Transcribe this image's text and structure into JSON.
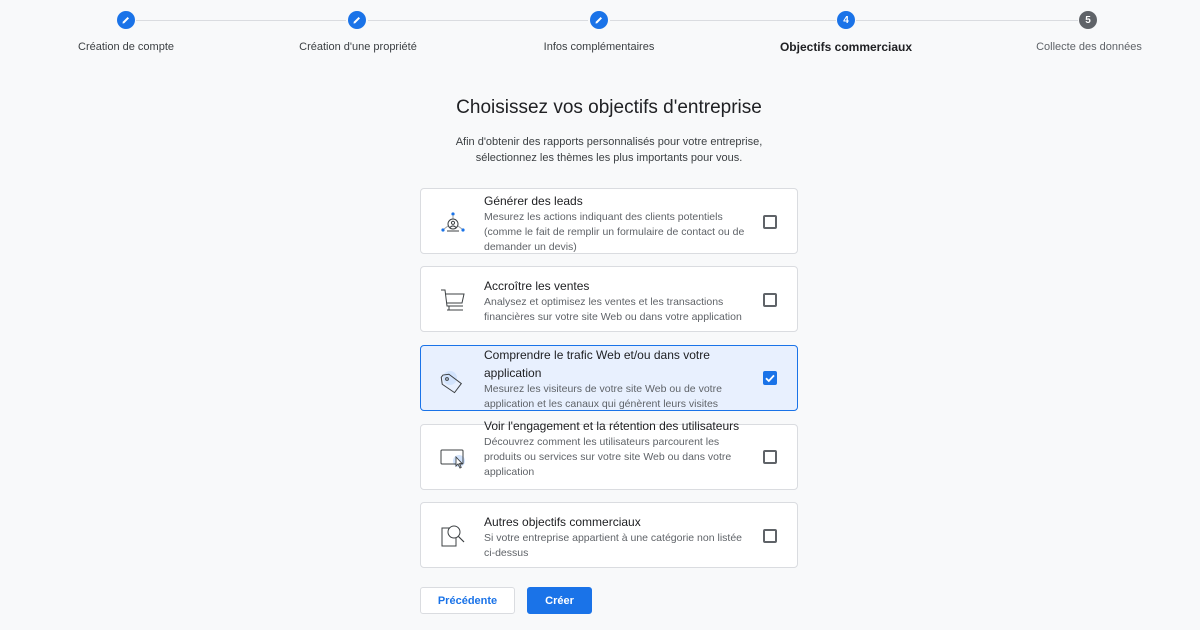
{
  "colors": {
    "accent": "#1a73e8",
    "selected_bg": "#e8f0fe",
    "muted": "#5f6368"
  },
  "stepper": {
    "steps": [
      {
        "number": "1",
        "label": "Création de compte",
        "state": "done",
        "icon": "pencil-icon"
      },
      {
        "number": "2",
        "label": "Création d'une propriété",
        "state": "done",
        "icon": "pencil-icon"
      },
      {
        "number": "3",
        "label": "Infos complémentaires",
        "state": "done",
        "icon": "pencil-icon"
      },
      {
        "number": "4",
        "label": "Objectifs commerciaux",
        "state": "active"
      },
      {
        "number": "5",
        "label": "Collecte des données",
        "state": "todo"
      }
    ]
  },
  "main": {
    "title": "Choisissez vos objectifs d'entreprise",
    "subtitle_line1": "Afin d'obtenir des rapports personnalisés pour votre entreprise,",
    "subtitle_line2": "sélectionnez les thèmes les plus importants pour vous."
  },
  "options": [
    {
      "title": "Générer des leads",
      "desc": "Mesurez les actions indiquant des clients potentiels (comme le fait de remplir un formulaire de contact ou de demander un devis)",
      "icon": "lead-network-icon",
      "checked": false
    },
    {
      "title": "Accroître les ventes",
      "desc": "Analysez et optimisez les ventes et les transactions financières sur votre site Web ou dans votre application",
      "icon": "shopping-cart-icon",
      "checked": false
    },
    {
      "title": "Comprendre le trafic Web et/ou dans votre application",
      "desc": "Mesurez les visiteurs de votre site Web ou de votre application et les canaux qui génèrent leurs visites",
      "icon": "price-tag-icon",
      "checked": true
    },
    {
      "title": "Voir l'engagement et la rétention des utilisateurs",
      "desc": "Découvrez comment les utilisateurs parcourent les produits ou services sur votre site Web ou dans votre application",
      "icon": "screen-cursor-icon",
      "checked": false
    },
    {
      "title": "Autres objectifs commerciaux",
      "desc": "Si votre entreprise appartient à une catégorie non listée ci-dessus",
      "icon": "magnifier-icon",
      "checked": false
    }
  ],
  "buttons": {
    "previous": "Précédente",
    "create": "Créer"
  }
}
